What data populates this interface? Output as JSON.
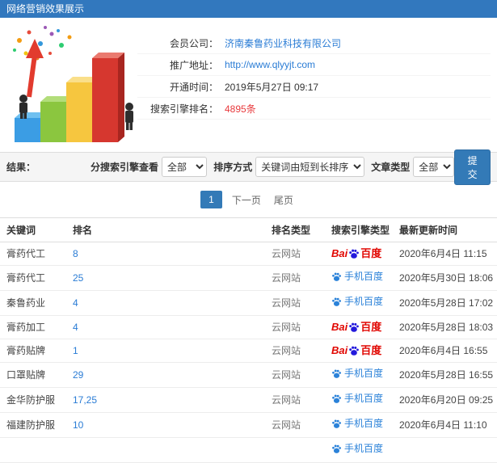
{
  "header": {
    "title": "网络营销效果展示"
  },
  "colors": {
    "topbar": "#3278be",
    "accent": "#337ab7",
    "link": "#2a7cd5",
    "highlight_red": "#e8393c",
    "baidu_red": "#e10601",
    "baidu_blue": "#2319dc",
    "mobile_baidu_blue": "#2b82d9"
  },
  "company_info": {
    "fields": [
      {
        "label": "会员公司：",
        "value": "济南秦鲁药业科技有限公司"
      },
      {
        "label": "推广地址：",
        "value": "http://www.qlyyjt.com"
      },
      {
        "label": "开通时间：",
        "value": "2019年5月27日 09:17"
      },
      {
        "label": "搜索引擎排名：",
        "value": "4895",
        "suffix": "条"
      }
    ]
  },
  "filters": {
    "section_label": "结果：",
    "engine_label": "分搜索引擎查看",
    "engine_value": "全部",
    "sort_label": "排序方式",
    "sort_value": "关键词由短到长排序",
    "article_label": "文章类型",
    "article_value": "全部",
    "submit_label": "提交"
  },
  "pagination": {
    "current": "1",
    "next": "下一页",
    "last": "尾页"
  },
  "table": {
    "headers": [
      "关键词",
      "排名",
      "排名类型",
      "搜索引擎类型",
      "最新更新时间"
    ],
    "engine_labels": {
      "baidu_text": "Bai",
      "baidu_cn": "百度",
      "mobile_text": "手机百度"
    },
    "rows": [
      {
        "keyword": "膏药代工",
        "rank": "8",
        "rank_type": "云网站",
        "engine": "baidu",
        "time": "2020年6月4日 11:15"
      },
      {
        "keyword": "膏药代工",
        "rank": "25",
        "rank_type": "云网站",
        "engine": "mobile",
        "time": "2020年5月30日 18:06"
      },
      {
        "keyword": "秦鲁药业",
        "rank": "4",
        "rank_type": "云网站",
        "engine": "mobile",
        "time": "2020年5月28日 17:02"
      },
      {
        "keyword": "膏药加工",
        "rank": "4",
        "rank_type": "云网站",
        "engine": "baidu",
        "time": "2020年5月28日 18:03"
      },
      {
        "keyword": "膏药贴牌",
        "rank": "1",
        "rank_type": "云网站",
        "engine": "baidu",
        "time": "2020年6月4日 16:55"
      },
      {
        "keyword": "口罩贴牌",
        "rank": "29",
        "rank_type": "云网站",
        "engine": "mobile",
        "time": "2020年5月28日 16:55"
      },
      {
        "keyword": "金华防护服",
        "rank": "17,25",
        "rank_type": "云网站",
        "engine": "mobile",
        "time": "2020年6月20日 09:25"
      },
      {
        "keyword": "福建防护服",
        "rank": "10",
        "rank_type": "云网站",
        "engine": "mobile",
        "time": "2020年6月4日 11:10"
      },
      {
        "keyword": "",
        "rank": "",
        "rank_type": "",
        "engine": "mobile",
        "time": ""
      }
    ]
  }
}
